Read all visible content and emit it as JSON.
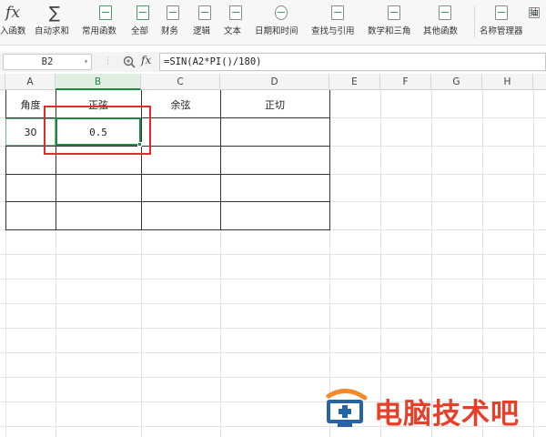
{
  "ribbon": {
    "items": [
      {
        "label": "入函数",
        "icon": "fx-icon"
      },
      {
        "label": "自动求和",
        "icon": "sigma-icon"
      },
      {
        "label": "常用函数",
        "icon": "common-functions-icon"
      },
      {
        "label": "全部",
        "icon": "all-functions-icon"
      },
      {
        "label": "财务",
        "icon": "finance-icon"
      },
      {
        "label": "逻辑",
        "icon": "logic-icon"
      },
      {
        "label": "文本",
        "icon": "text-icon"
      },
      {
        "label": "日期和时间",
        "icon": "clock-icon"
      },
      {
        "label": "查找与引用",
        "icon": "lookup-icon"
      },
      {
        "label": "数学和三角",
        "icon": "math-icon"
      },
      {
        "label": "其他函数",
        "icon": "other-functions-icon"
      },
      {
        "label": "名称管理器",
        "icon": "name-manager-icon"
      }
    ],
    "fx_glyph": "fx",
    "sigma_glyph": "∑",
    "cut_off_label": "抽"
  },
  "formula_bar": {
    "name_box": "B2",
    "fx_label": "fx",
    "formula": "=SIN(A2*PI()/180)"
  },
  "columns": [
    "A",
    "B",
    "C",
    "D",
    "E",
    "F",
    "G",
    "H"
  ],
  "active_column": "B",
  "table": {
    "headers": [
      "角度",
      "正弦",
      "余弦",
      "正切"
    ],
    "rows": [
      [
        "30",
        "0.5",
        "",
        ""
      ]
    ]
  },
  "watermark": {
    "text": "电脑技术吧",
    "color": "#e63f2a"
  },
  "colors": {
    "selection": "#1e8a41",
    "highlight_box": "#e02c2c"
  }
}
